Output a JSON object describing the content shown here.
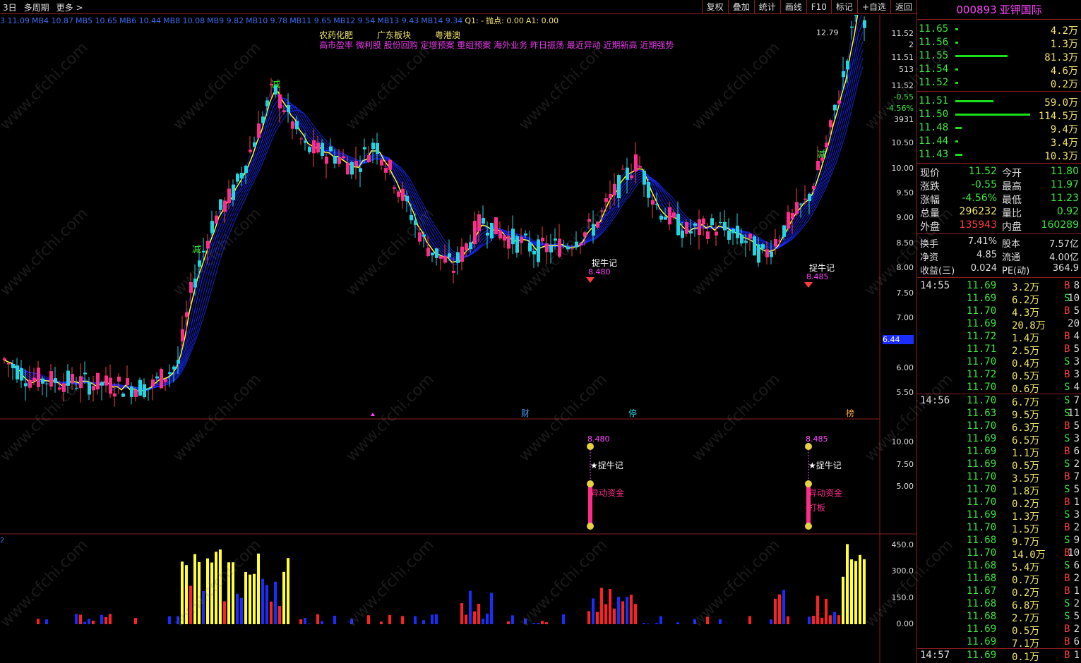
{
  "toolbar": {
    "period_3d": "3日",
    "multi_period": "多周期",
    "more": "更多 >",
    "right_buttons": [
      "复权",
      "叠加",
      "统计",
      "画线",
      "F10",
      "标记",
      "+自选",
      "返回"
    ]
  },
  "ma_bar": [
    {
      "text": "3  11.09",
      "color": "#3b6cf0"
    },
    {
      "text": "MB4  10.87",
      "color": "#3b6cf0"
    },
    {
      "text": "MB5  10.65",
      "color": "#3b6cf0"
    },
    {
      "text": "MB6  10.44",
      "color": "#3b6cf0"
    },
    {
      "text": "MB8  10.08",
      "color": "#3b6cf0"
    },
    {
      "text": "MB9  9.82",
      "color": "#3b6cf0"
    },
    {
      "text": "MB10  9.78",
      "color": "#3b6cf0"
    },
    {
      "text": "MB11  9.65",
      "color": "#3b6cf0"
    },
    {
      "text": "MB12  9.54",
      "color": "#3b6cf0"
    },
    {
      "text": "MB13  9.43",
      "color": "#3b6cf0"
    },
    {
      "text": "MB14  9.34",
      "color": "#3b6cf0"
    },
    {
      "text": "Q1: -",
      "color": "#f0e36a"
    },
    {
      "text": "抛点: 0.00",
      "color": "#f0e36a"
    },
    {
      "text": "A1: 0.00",
      "color": "#f0e36a"
    }
  ],
  "concepts_row1": [
    "农药化肥",
    "广东板块",
    "粤港澳"
  ],
  "concepts_row2": "高市盈率  微利股  股份回购  定增预案  重组预案  海外业务  昨日振荡  最近异动  近期新高  近期强势",
  "chart_markers": {
    "jian1": "减",
    "jian2": "减",
    "jian3": "减",
    "tiniu1": "捉牛记",
    "tiniu2": "捉牛记",
    "price1": "8.480",
    "price2": "8.485",
    "high_label": "12.79",
    "cai": "财",
    "ting": "停",
    "bang": "榜"
  },
  "main_axis": [
    "11.52",
    "2",
    "11.51",
    "513",
    "11.52",
    "-0.55",
    "-4.56%",
    "3931",
    "10.50",
    "10.00",
    "9.50",
    "9.00",
    "8.50",
    "8.00",
    "7.50",
    "7.00",
    "6.44",
    "6.00",
    "5.50"
  ],
  "mid_axis": [
    "10.00",
    "7.50",
    "5.00"
  ],
  "vol_axis": [
    "450.0",
    "300.0",
    "150.0",
    "0.00"
  ],
  "mid_pane": {
    "p1": "8.480",
    "p2": "8.485",
    "n1": "★捉牛记",
    "n2": "★捉牛记",
    "f1": "异动资金",
    "f2": "异动资金",
    "f3": "打板"
  },
  "vol_label": "2",
  "stock": {
    "code": "000893",
    "name": "亚钾国际"
  },
  "asks": [
    {
      "price": "11.65",
      "vol": "4.2万",
      "bar": 4
    },
    {
      "price": "11.56",
      "vol": "1.3万",
      "bar": 4
    },
    {
      "price": "11.55",
      "vol": "81.3万",
      "bar": 74
    },
    {
      "price": "11.54",
      "vol": "4.6万",
      "bar": 4
    },
    {
      "price": "11.52",
      "vol": "0.2万",
      "bar": 4
    }
  ],
  "bids": [
    {
      "price": "11.51",
      "vol": "59.0万",
      "bar": 54
    },
    {
      "price": "11.50",
      "vol": "114.5万",
      "bar": 106
    },
    {
      "price": "11.48",
      "vol": "9.4万",
      "bar": 9
    },
    {
      "price": "11.44",
      "vol": "3.4万",
      "bar": 4
    },
    {
      "price": "11.43",
      "vol": "10.3万",
      "bar": 10
    }
  ],
  "quote": [
    {
      "l1": "现价",
      "v1": "11.52",
      "c1": "#3be83b",
      "l2": "今开",
      "v2": "11.80",
      "c2": "#3be83b"
    },
    {
      "l1": "涨跌",
      "v1": "-0.55",
      "c1": "#3be83b",
      "l2": "最高",
      "v2": "11.97",
      "c2": "#3be83b"
    },
    {
      "l1": "涨幅",
      "v1": "-4.56%",
      "c1": "#3be83b",
      "l2": "最低",
      "v2": "11.23",
      "c2": "#3be83b"
    },
    {
      "l1": "总量",
      "v1": "296232",
      "c1": "#f0e36a",
      "l2": "量比",
      "v2": "0.92",
      "c2": "#3be83b"
    },
    {
      "l1": "外盘",
      "v1": "135943",
      "c1": "#ff3b3b",
      "l2": "内盘",
      "v2": "160289",
      "c2": "#3be83b"
    }
  ],
  "quote2": [
    {
      "l1": "换手",
      "v1": "7.41%",
      "l2": "股本",
      "v2": "7.57亿"
    },
    {
      "l1": "净资",
      "v1": "4.85",
      "l2": "流通",
      "v2": "4.00亿"
    },
    {
      "l1": "收益(三)",
      "v1": "0.024",
      "l2": "PE(动)",
      "v2": "364.9"
    }
  ],
  "ticks1": {
    "time": "14:55",
    "rows": [
      [
        "11.69",
        "3.2万",
        "B",
        "8"
      ],
      [
        "11.69",
        "6.2万",
        "S",
        "10"
      ],
      [
        "11.70",
        "4.3万",
        "B",
        "5"
      ],
      [
        "11.69",
        "20.8万",
        "",
        "20"
      ],
      [
        "11.72",
        "1.4万",
        "B",
        "4"
      ],
      [
        "11.71",
        "2.5万",
        "B",
        "5"
      ],
      [
        "11.70",
        "0.4万",
        "S",
        "3"
      ],
      [
        "11.72",
        "0.5万",
        "B",
        "3"
      ],
      [
        "11.70",
        "0.6万",
        "S",
        "4"
      ]
    ]
  },
  "ticks2": {
    "time": "14:56",
    "rows": [
      [
        "11.70",
        "6.7万",
        "S",
        "7"
      ],
      [
        "11.63",
        "9.5万",
        "S",
        "11"
      ],
      [
        "11.70",
        "6.3万",
        "B",
        "5"
      ],
      [
        "11.69",
        "6.5万",
        "S",
        "3"
      ],
      [
        "11.69",
        "1.1万",
        "B",
        "6"
      ],
      [
        "11.69",
        "0.5万",
        "S",
        "2"
      ],
      [
        "11.70",
        "3.5万",
        "B",
        "7"
      ],
      [
        "11.70",
        "1.8万",
        "S",
        "5"
      ],
      [
        "11.70",
        "0.2万",
        "B",
        "1"
      ],
      [
        "11.69",
        "1.3万",
        "S",
        "3"
      ],
      [
        "11.70",
        "1.5万",
        "B",
        "2"
      ],
      [
        "11.68",
        "9.7万",
        "S",
        "9"
      ],
      [
        "11.70",
        "14.0万",
        "B",
        "10"
      ],
      [
        "11.68",
        "5.4万",
        "S",
        "6"
      ],
      [
        "11.68",
        "0.7万",
        "B",
        "2"
      ],
      [
        "11.67",
        "0.2万",
        "B",
        "1"
      ],
      [
        "11.68",
        "6.8万",
        "S",
        "2"
      ],
      [
        "11.68",
        "2.7万",
        "S",
        "5"
      ],
      [
        "11.69",
        "0.5万",
        "B",
        "2"
      ],
      [
        "11.69",
        "7.1万",
        "B",
        "6"
      ]
    ]
  },
  "ticks3": {
    "time": "14:57",
    "rows": [
      [
        "11.69",
        "0.1万",
        "B",
        "1"
      ]
    ]
  },
  "watermark": "www.cfchi.com",
  "colors": {
    "up": "#ff2d8a",
    "down": "#22d6e0",
    "ma_yellow": "#ffff33",
    "ribbon": "#1a2cff",
    "grid": "#8a1e1e",
    "buy": "#ff3b3b",
    "sell": "#3be83b"
  }
}
